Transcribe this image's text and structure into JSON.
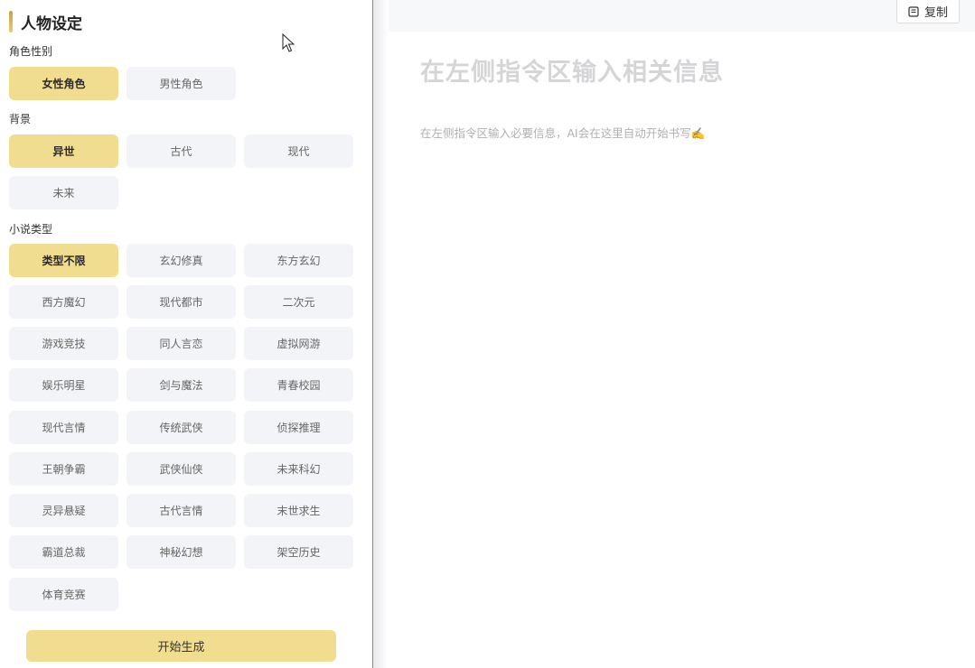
{
  "left_panel": {
    "title": "人物设定",
    "sections": {
      "gender": {
        "label": "角色性别",
        "options": [
          "女性角色",
          "男性角色"
        ],
        "selected": "女性角色"
      },
      "background": {
        "label": "背景",
        "options": [
          "异世",
          "古代",
          "现代",
          "未来"
        ],
        "selected": "异世"
      },
      "genre": {
        "label": "小说类型",
        "options": [
          "类型不限",
          "玄幻修真",
          "东方玄幻",
          "西方魔幻",
          "现代都市",
          "二次元",
          "游戏竞技",
          "同人言恋",
          "虚拟网游",
          "娱乐明星",
          "剑与魔法",
          "青春校园",
          "现代言情",
          "传统武侠",
          "侦探推理",
          "王朝争霸",
          "武侠仙侠",
          "未来科幻",
          "灵异悬疑",
          "古代言情",
          "末世求生",
          "霸道总裁",
          "神秘幻想",
          "架空历史",
          "体育竞赛"
        ],
        "selected": "类型不限"
      }
    },
    "start_button": "开始生成"
  },
  "right_panel": {
    "copy_button": "复制",
    "title": "在左侧指令区输入相关信息",
    "hint": "在左侧指令区输入必要信息，AI会在这里自动开始书写✍️"
  },
  "icons": {
    "copy": "copy-icon",
    "cursor": "mouse-cursor-icon"
  },
  "colors": {
    "accent": "#f1dd8f",
    "chip_bg": "#f3f4f7"
  }
}
